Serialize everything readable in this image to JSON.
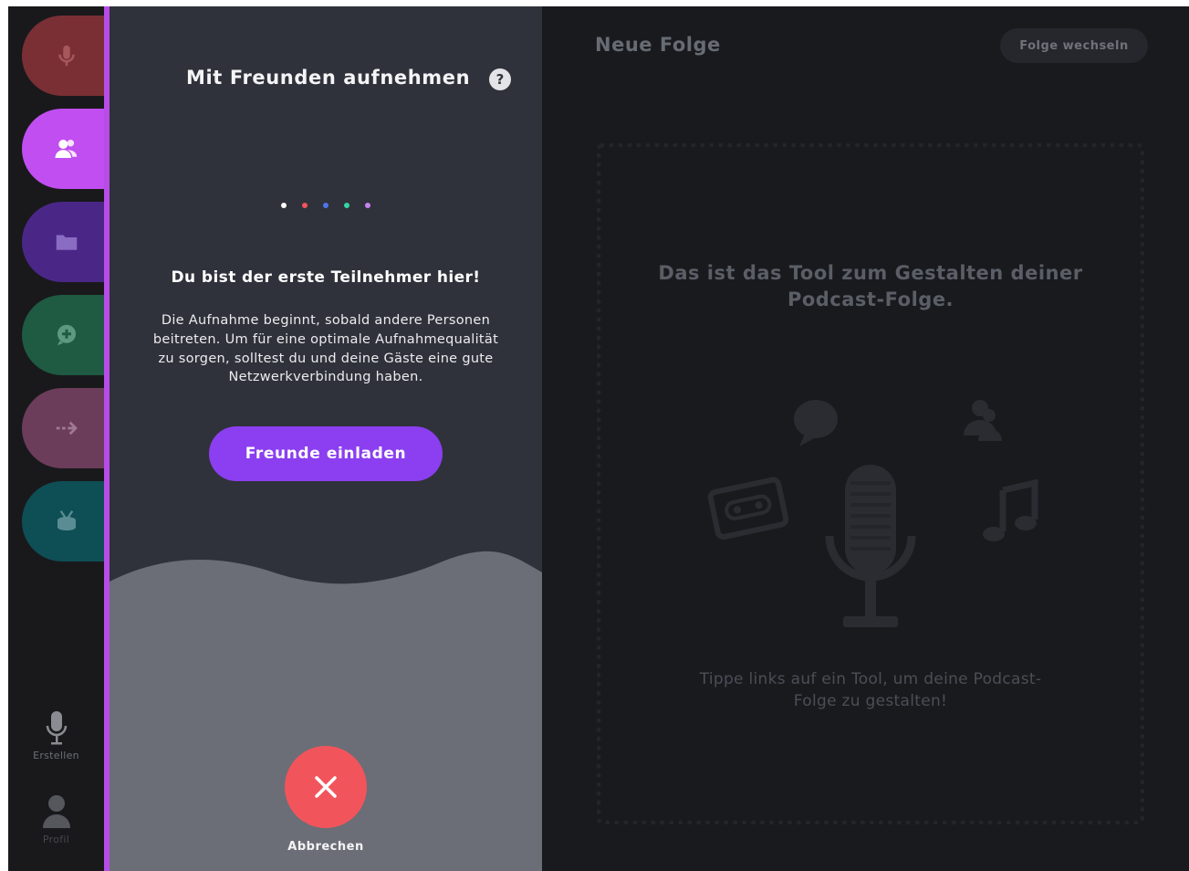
{
  "rail": {
    "tools": [
      {
        "name": "record",
        "icon": "microphone-icon",
        "color": "#7a2f35"
      },
      {
        "name": "friends",
        "icon": "people-icon",
        "color": "#c14ef0",
        "active": true
      },
      {
        "name": "files",
        "icon": "folder-icon",
        "color": "#4a2787"
      },
      {
        "name": "add-sound",
        "icon": "chat-plus-icon",
        "color": "#1f5a43"
      },
      {
        "name": "transition",
        "icon": "arrow-right-icon",
        "color": "#6b3d5a"
      },
      {
        "name": "jingle",
        "icon": "drum-icon",
        "color": "#0e4e55"
      }
    ],
    "bottom": {
      "create_label": "Erstellen",
      "profile_label": "Profil"
    },
    "accent_color": "#b84ce6"
  },
  "panel": {
    "title": "Mit Freunden aufnehmen",
    "help_symbol": "?",
    "dots": [
      "#ffffff",
      "#f2545b",
      "#4f74e8",
      "#34d6a3",
      "#c981ee"
    ],
    "heading": "Du bist der erste Teilnehmer hier!",
    "body": "Die Aufnahme beginnt, sobald andere Personen beitreten. Um für eine optimale Aufnahmequalität zu sorgen, solltest du und deine Gäste eine gute Netzwerkverbindung haben.",
    "invite_label": "Freunde einladen",
    "cancel_label": "Abbrechen"
  },
  "main": {
    "title": "Neue Folge",
    "switch_label": "Folge wechseln",
    "dropzone_title": "Das ist das Tool zum Gestalten deiner Podcast-Folge.",
    "dropzone_hint": "Tippe links auf ein Tool, um deine Podcast-Folge zu gestalten!"
  }
}
